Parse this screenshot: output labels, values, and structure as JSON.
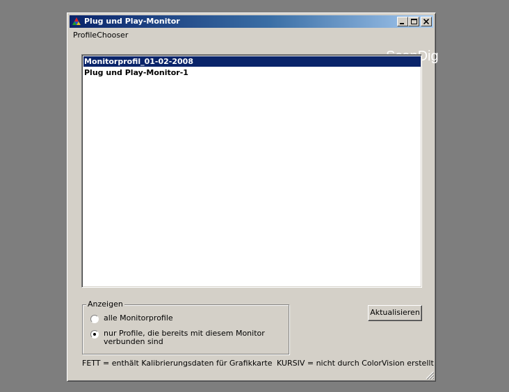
{
  "window": {
    "title": "Plug und Play-Monitor",
    "buttons": [
      "minimize",
      "maximize",
      "close"
    ]
  },
  "menu": {
    "items": [
      "ProfileChooser"
    ]
  },
  "watermark": "ScanDig",
  "profiles": {
    "items": [
      {
        "label": "Monitorprofil_01-02-2008",
        "selected": true
      },
      {
        "label": "Plug und Play-Monitor-1",
        "selected": false
      }
    ]
  },
  "show_group": {
    "label": "Anzeigen",
    "options": [
      {
        "label": "alle Monitorprofile",
        "checked": false
      },
      {
        "label": "nur Profile, die bereits mit diesem Monitor verbunden sind",
        "checked": true
      }
    ]
  },
  "refresh_button": "Aktualisieren",
  "legend": {
    "bold": "FETT = enthält Kalibrierungsdaten für Grafikkarte",
    "italic": "KURSIV = nicht durch ColorVision erstellt"
  },
  "colors": {
    "desktop": "#7e7e7e",
    "window_face": "#d4d0c8",
    "titlebar_start": "#0a246a",
    "titlebar_end": "#a6caf0",
    "selection": "#0a246a"
  },
  "icons": [
    "colorvision-app-icon",
    "minimize-icon",
    "maximize-icon",
    "close-icon",
    "resize-grip-icon"
  ]
}
